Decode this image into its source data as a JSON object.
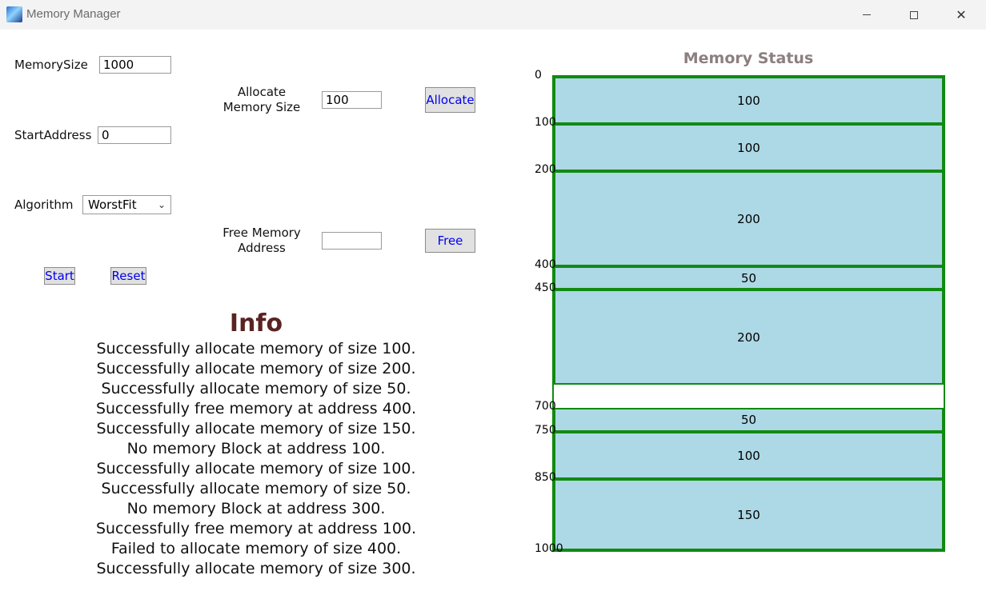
{
  "window": {
    "title": "Memory Manager"
  },
  "form": {
    "memory_size_label": "MemorySize",
    "memory_size_value": "1000",
    "start_address_label": "StartAddress",
    "start_address_value": "0",
    "algorithm_label": "Algorithm",
    "algorithm_value": "WorstFit",
    "allocate_label_line1": "Allocate",
    "allocate_label_line2": "Memory Size",
    "allocate_value": "100",
    "allocate_button": "Allocate",
    "free_label_line1": "Free Memory",
    "free_label_line2": "Address",
    "free_value": "",
    "free_button": "Free",
    "start_button": "Start",
    "reset_button": "Reset"
  },
  "info": {
    "title": "Info",
    "messages": [
      "Successfully allocate memory of size 100.",
      "Successfully allocate memory of size 200.",
      "Successfully allocate memory of size 50.",
      "Successfully free memory at address 400.",
      "Successfully allocate memory of size 150.",
      "No memory Block at address 100.",
      "Successfully allocate memory of size 100.",
      "Successfully allocate memory of size 50.",
      "No memory Block at address 300.",
      "Successfully free memory at address 100.",
      "Failed to allocate memory of size 400.",
      "Successfully allocate memory of size 300."
    ]
  },
  "memory_status": {
    "title": "Memory Status",
    "total": 1000,
    "blocks": [
      {
        "start": 0,
        "size": 100,
        "label": "100"
      },
      {
        "start": 100,
        "size": 100,
        "label": "100"
      },
      {
        "start": 200,
        "size": 200,
        "label": "200"
      },
      {
        "start": 400,
        "size": 50,
        "label": "50"
      },
      {
        "start": 450,
        "size": 200,
        "label": "200"
      },
      {
        "start": 700,
        "size": 50,
        "label": "50"
      },
      {
        "start": 750,
        "size": 100,
        "label": "100"
      },
      {
        "start": 850,
        "size": 150,
        "label": "150"
      }
    ],
    "address_labels": [
      "0",
      "100",
      "200",
      "400",
      "450",
      "700",
      "750",
      "850",
      "1000"
    ]
  },
  "colors": {
    "block_fill": "#add8e6",
    "block_border": "#118a11",
    "info_title": "#5a2323",
    "status_title": "#8c7f7f",
    "button_text": "#0000ee"
  }
}
